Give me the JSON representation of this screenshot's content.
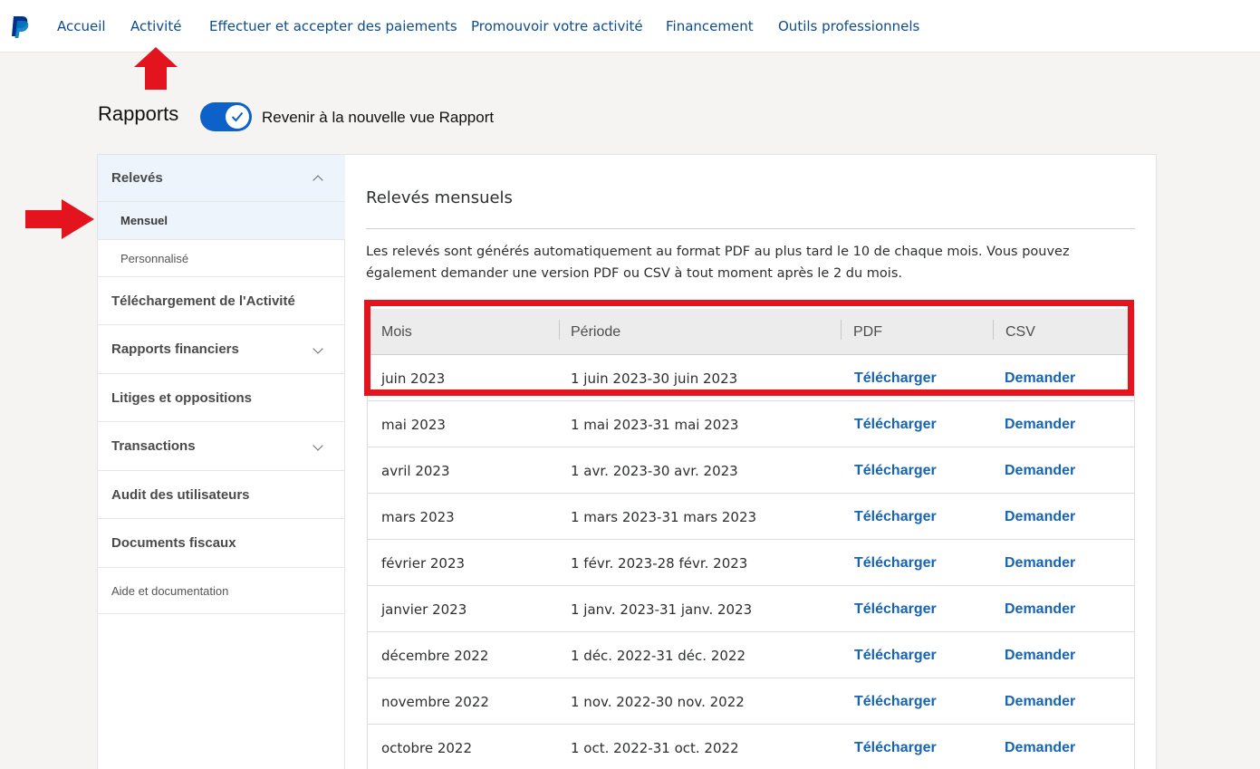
{
  "nav": {
    "items": [
      "Accueil",
      "Activité",
      "Effectuer et accepter des paiements",
      "Promouvoir votre activité",
      "Financement",
      "Outils professionnels"
    ]
  },
  "header": {
    "title": "Rapports",
    "toggle_label": "Revenir à la nouvelle vue Rapport",
    "toggle_on": true
  },
  "sidebar": {
    "items": [
      {
        "label": "Relevés",
        "kind": "parent-open"
      },
      {
        "label": "Mensuel",
        "kind": "sub-active"
      },
      {
        "label": "Personnalisé",
        "kind": "sub"
      },
      {
        "label": "Téléchargement de l'Activité",
        "kind": "item"
      },
      {
        "label": "Rapports financiers",
        "kind": "collapsed"
      },
      {
        "label": "Litiges et oppositions",
        "kind": "item"
      },
      {
        "label": "Transactions",
        "kind": "collapsed"
      },
      {
        "label": "Audit des utilisateurs",
        "kind": "item"
      },
      {
        "label": "Documents fiscaux",
        "kind": "item"
      },
      {
        "label": "Aide et documentation",
        "kind": "help"
      }
    ]
  },
  "main": {
    "title": "Relevés mensuels",
    "description": "Les relevés sont générés automatiquement au format PDF au plus tard le 10 de chaque mois. Vous pouvez également demander une version PDF ou CSV à tout moment après le 2 du mois.",
    "table": {
      "headers": [
        "Mois",
        "Période",
        "PDF",
        "CSV"
      ],
      "rows": [
        {
          "month": "juin 2023",
          "period": "1 juin 2023-30 juin 2023",
          "pdf": "Télécharger",
          "csv": "Demander"
        },
        {
          "month": "mai 2023",
          "period": "1 mai 2023-31 mai 2023",
          "pdf": "Télécharger",
          "csv": "Demander"
        },
        {
          "month": "avril 2023",
          "period": "1 avr. 2023-30 avr. 2023",
          "pdf": "Télécharger",
          "csv": "Demander"
        },
        {
          "month": "mars 2023",
          "period": "1 mars 2023-31 mars 2023",
          "pdf": "Télécharger",
          "csv": "Demander"
        },
        {
          "month": "février 2023",
          "period": "1 févr. 2023-28 févr. 2023",
          "pdf": "Télécharger",
          "csv": "Demander"
        },
        {
          "month": "janvier 2023",
          "period": "1 janv. 2023-31 janv. 2023",
          "pdf": "Télécharger",
          "csv": "Demander"
        },
        {
          "month": "décembre 2022",
          "period": "1 déc. 2022-31 déc. 2022",
          "pdf": "Télécharger",
          "csv": "Demander"
        },
        {
          "month": "novembre 2022",
          "period": "1 nov. 2022-30 nov. 2022",
          "pdf": "Télécharger",
          "csv": "Demander"
        },
        {
          "month": "octobre 2022",
          "period": "1 oct. 2022-31 oct. 2022",
          "pdf": "Télécharger",
          "csv": "Demander"
        }
      ]
    }
  },
  "colors": {
    "brand_link": "#0c4d8c",
    "toggle": "#0d62c9",
    "action_link": "#1664b4",
    "annotation_red": "#e3141d"
  }
}
